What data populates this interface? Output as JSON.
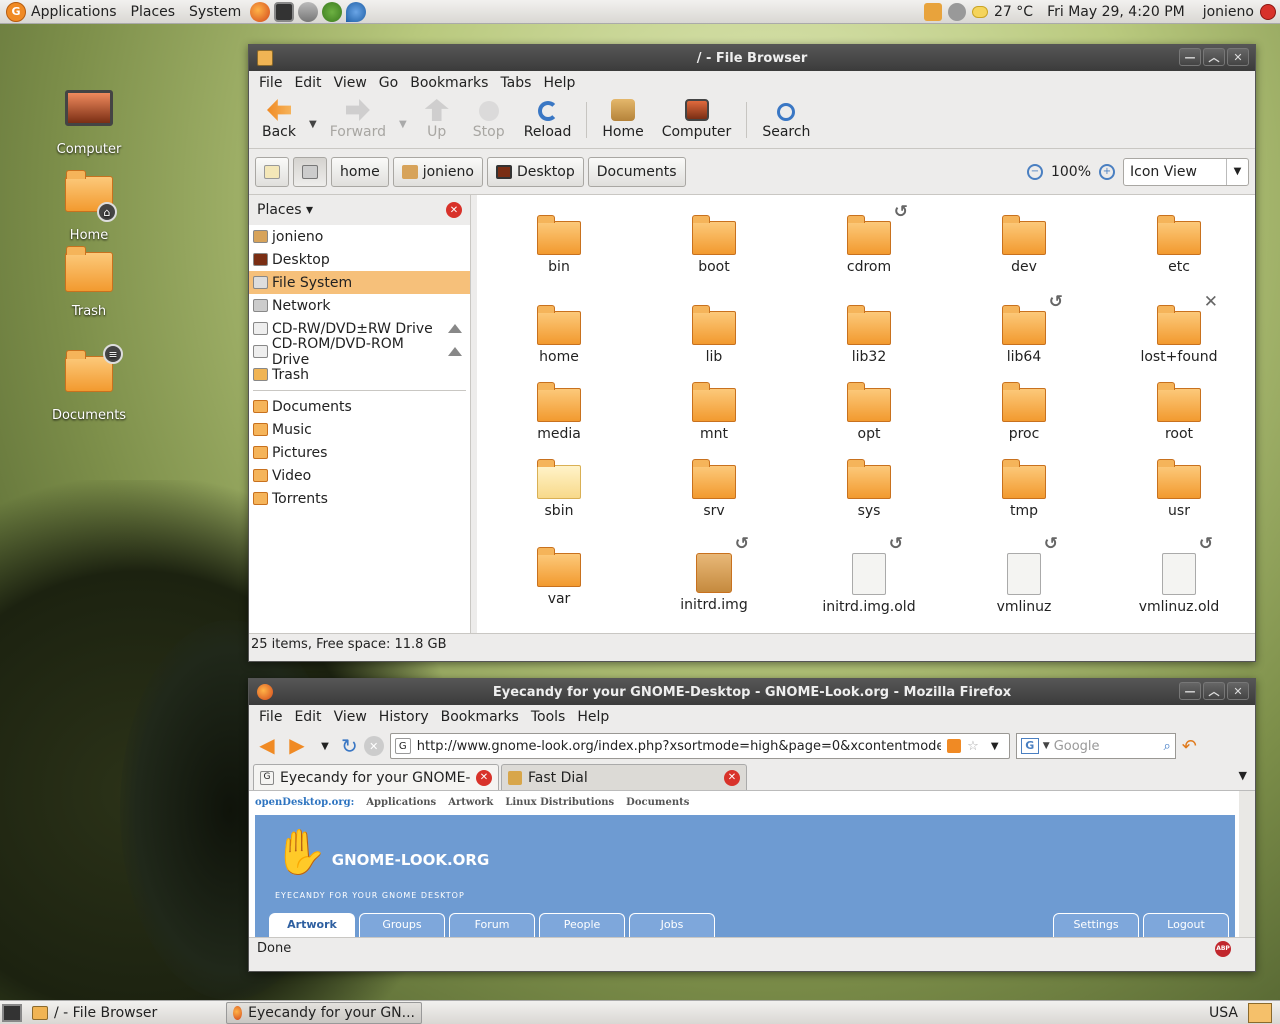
{
  "top_panel": {
    "menus": [
      "Applications",
      "Places",
      "System"
    ],
    "temperature": "27 °C",
    "datetime": "Fri May 29,  4:20 PM",
    "user": "jonieno"
  },
  "desktop_icons": [
    {
      "label": "Computer",
      "icon": "computer-icon"
    },
    {
      "label": "Home",
      "icon": "home-folder-icon"
    },
    {
      "label": "Trash",
      "icon": "trash-icon"
    },
    {
      "label": "Documents",
      "icon": "documents-folder-icon"
    }
  ],
  "file_browser": {
    "title": "/ - File Browser",
    "menus": [
      "File",
      "Edit",
      "View",
      "Go",
      "Bookmarks",
      "Tabs",
      "Help"
    ],
    "toolbar": {
      "back": "Back",
      "forward": "Forward",
      "up": "Up",
      "stop": "Stop",
      "reload": "Reload",
      "home": "Home",
      "computer": "Computer",
      "search": "Search"
    },
    "path": [
      "home",
      "jonieno",
      "Desktop",
      "Documents"
    ],
    "zoom": "100%",
    "view_mode": "Icon View",
    "side_header": "Places",
    "places": [
      {
        "label": "jonieno",
        "eject": false,
        "selected": false
      },
      {
        "label": "Desktop",
        "eject": false,
        "selected": false
      },
      {
        "label": "File System",
        "eject": false,
        "selected": true
      },
      {
        "label": "Network",
        "eject": false,
        "selected": false
      },
      {
        "label": "CD-RW/DVD±RW Drive",
        "eject": true,
        "selected": false
      },
      {
        "label": "CD-ROM/DVD-ROM Drive",
        "eject": true,
        "selected": false
      },
      {
        "label": "Trash",
        "eject": false,
        "selected": false
      }
    ],
    "bookmarks": [
      "Documents",
      "Music",
      "Pictures",
      "Video",
      "Torrents"
    ],
    "files": [
      {
        "name": "bin",
        "kind": "folder",
        "emblem": ""
      },
      {
        "name": "boot",
        "kind": "folder",
        "emblem": ""
      },
      {
        "name": "cdrom",
        "kind": "folder",
        "emblem": "symlink"
      },
      {
        "name": "dev",
        "kind": "folder",
        "emblem": ""
      },
      {
        "name": "etc",
        "kind": "folder",
        "emblem": ""
      },
      {
        "name": "home",
        "kind": "folder",
        "emblem": ""
      },
      {
        "name": "lib",
        "kind": "folder",
        "emblem": ""
      },
      {
        "name": "lib32",
        "kind": "folder",
        "emblem": ""
      },
      {
        "name": "lib64",
        "kind": "folder",
        "emblem": "symlink"
      },
      {
        "name": "lost+found",
        "kind": "folder",
        "emblem": "noaccess"
      },
      {
        "name": "media",
        "kind": "folder",
        "emblem": ""
      },
      {
        "name": "mnt",
        "kind": "folder",
        "emblem": ""
      },
      {
        "name": "opt",
        "kind": "folder",
        "emblem": ""
      },
      {
        "name": "proc",
        "kind": "folder",
        "emblem": ""
      },
      {
        "name": "root",
        "kind": "folder",
        "emblem": ""
      },
      {
        "name": "sbin",
        "kind": "folder-pale",
        "emblem": ""
      },
      {
        "name": "srv",
        "kind": "folder",
        "emblem": ""
      },
      {
        "name": "sys",
        "kind": "folder",
        "emblem": ""
      },
      {
        "name": "tmp",
        "kind": "folder",
        "emblem": ""
      },
      {
        "name": "usr",
        "kind": "folder",
        "emblem": ""
      },
      {
        "name": "var",
        "kind": "folder",
        "emblem": ""
      },
      {
        "name": "initrd.img",
        "kind": "package",
        "emblem": "symlink"
      },
      {
        "name": "initrd.img.old",
        "kind": "doc",
        "emblem": "symlink"
      },
      {
        "name": "vmlinuz",
        "kind": "doc",
        "emblem": "symlink"
      },
      {
        "name": "vmlinuz.old",
        "kind": "doc",
        "emblem": "symlink"
      }
    ],
    "status": "25 items, Free space: 11.8 GB"
  },
  "firefox": {
    "title": "Eyecandy for your GNOME-Desktop - GNOME-Look.org - Mozilla Firefox",
    "menus": [
      "File",
      "Edit",
      "View",
      "History",
      "Bookmarks",
      "Tools",
      "Help"
    ],
    "url": "http://www.gnome-look.org/index.php?xsortmode=high&page=0&xcontentmode=",
    "search_placeholder": "Google",
    "tabs": [
      {
        "title": "Eyecandy for your GNOME-D...",
        "active": true
      },
      {
        "title": "Fast Dial",
        "active": false
      }
    ],
    "page": {
      "od_brand": "openDesktop.org:",
      "od_links": [
        "Applications",
        "Artwork",
        "Linux Distributions",
        "Documents"
      ],
      "logo_text": "GNOME-LOOK.ORG",
      "tagline": "EYECANDY FOR YOUR GNOME DESKTOP",
      "site_tabs": [
        "Artwork",
        "Groups",
        "Forum",
        "People",
        "Jobs"
      ],
      "site_tabs_right": [
        "Settings",
        "Logout"
      ]
    },
    "status": "Done",
    "abp_label": "ABP"
  },
  "bottom_panel": {
    "tasks": [
      "/ - File Browser",
      "Eyecandy for your GN..."
    ],
    "keyboard_layout": "USA"
  }
}
